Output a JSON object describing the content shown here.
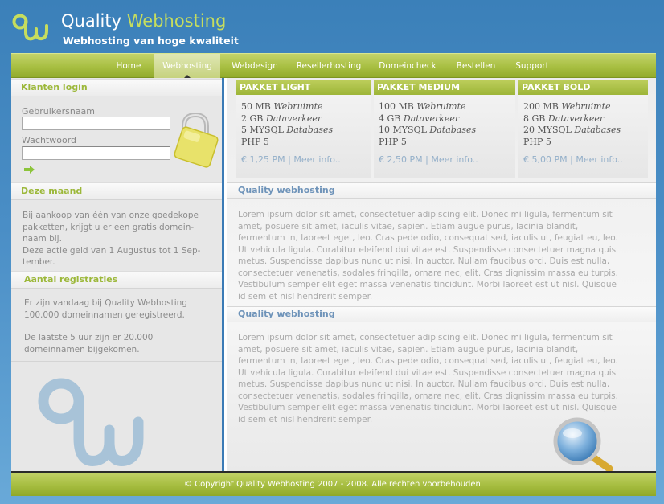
{
  "header": {
    "title_main": "Quality",
    "title_accent": "Webhosting",
    "tagline": "Webhosting van hoge kwaliteit"
  },
  "nav": {
    "items": [
      {
        "label": "Home"
      },
      {
        "label": "Webhosting"
      },
      {
        "label": "Webdesign"
      },
      {
        "label": "Resellerhosting"
      },
      {
        "label": "Domeincheck"
      },
      {
        "label": "Bestellen"
      },
      {
        "label": "Support"
      }
    ],
    "active": "Webhosting"
  },
  "sidebar": {
    "login": {
      "heading": "Klanten login",
      "username_label": "Gebruikersnaam",
      "username_value": "",
      "password_label": "Wachtwoord",
      "password_value": ""
    },
    "month": {
      "heading": "Deze maand",
      "line1": "Bij aankoop van één van onze goedekope",
      "line2": "pakketten, krijgt u er een gratis domein-",
      "line3": "naam bij.",
      "line4": "Deze actie geld van 1 Augustus tot 1 Sep-",
      "line5": "tember."
    },
    "registrations": {
      "heading": "Aantal registraties",
      "line1": "Er zijn vandaag bij Quality Webhosting",
      "line2": "100.000 domeinnamen geregistreerd.",
      "line3": "De laatste 5 uur zijn er 20.000",
      "line4": "domeinnamen bijgekomen."
    }
  },
  "packages": [
    {
      "name": "PAKKET LIGHT",
      "f1n": "50 MB",
      "f1": "Webruimte",
      "f2n": "2 GB",
      "f2": "Dataverkeer",
      "f3n": "5 MYSQL",
      "f3": "Databases",
      "php": "PHP 5",
      "price": "€ 1,25 PM",
      "sep": "|",
      "more": "Meer info.."
    },
    {
      "name": "PAKKET MEDIUM",
      "f1n": "100 MB",
      "f1": "Webruimte",
      "f2n": "4 GB",
      "f2": "Dataverkeer",
      "f3n": "10 MYSQL",
      "f3": "Databases",
      "php": "PHP 5",
      "price": "€ 2,50 PM",
      "sep": "|",
      "more": "Meer info.."
    },
    {
      "name": "PAKKET BOLD",
      "f1n": "200 MB",
      "f1": "Webruimte",
      "f2n": "8 GB",
      "f2": "Dataverkeer",
      "f3n": "20 MYSQL",
      "f3": "Databases",
      "php": "PHP 5",
      "price": "€ 5,00 PM",
      "sep": "|",
      "more": "Meer info.."
    }
  ],
  "sections": [
    {
      "heading": "Quality webhosting",
      "lines": [
        "Lorem ipsum dolor sit amet, consectetuer adipiscing elit. Donec mi ligula, fermentum sit",
        "amet, posuere sit amet, iaculis vitae, sapien. Etiam augue purus, lacinia blandit,",
        "fermentum in, laoreet eget, leo. Cras pede odio, consequat sed, iaculis ut, feugiat eu, leo.",
        "Ut vehicula ligula. Curabitur eleifend dui vitae est. Suspendisse consectetuer magna quis",
        "metus. Suspendisse dapibus nunc ut nisi. In auctor. Nullam faucibus orci. Duis est nulla,",
        "consectetuer venenatis, sodales fringilla, ornare nec, elit. Cras dignissim massa eu turpis.",
        "Vestibulum semper elit eget massa venenatis tincidunt. Morbi laoreet est ut nisl. Quisque",
        "id sem et nisl hendrerit semper."
      ]
    },
    {
      "heading": "Quality webhosting",
      "lines": [
        "Lorem ipsum dolor sit amet, consectetuer adipiscing elit. Donec mi ligula, fermentum sit",
        "amet, posuere sit amet, iaculis vitae, sapien. Etiam augue purus, lacinia blandit,",
        "fermentum in, laoreet eget, leo. Cras pede odio, consequat sed, iaculis ut, feugiat eu, leo.",
        "Ut vehicula ligula. Curabitur eleifend dui vitae est. Suspendisse consectetuer magna quis",
        "metus. Suspendisse dapibus nunc ut nisi. In auctor. Nullam faucibus orci. Duis est nulla,",
        "consectetuer venenatis, sodales fringilla, ornare nec, elit. Cras dignissim massa eu turpis.",
        "Vestibulum semper elit eget massa venenatis tincidunt. Morbi laoreet est ut nisl. Quisque",
        "id sem et nisl hendrerit semper."
      ]
    }
  ],
  "footer": {
    "copyright": "© Copyright Quality Webhosting 2007 - 2008. Alle rechten voorbehouden."
  },
  "icons": {
    "logo": "qw-logo-icon",
    "lock": "padlock-icon",
    "submit": "arrow-right-icon",
    "magnifier": "magnifier-icon"
  },
  "colors": {
    "accent_green": "#a8bf42",
    "brand_blue": "#3b7bb6",
    "link_blue": "#93afc9"
  }
}
